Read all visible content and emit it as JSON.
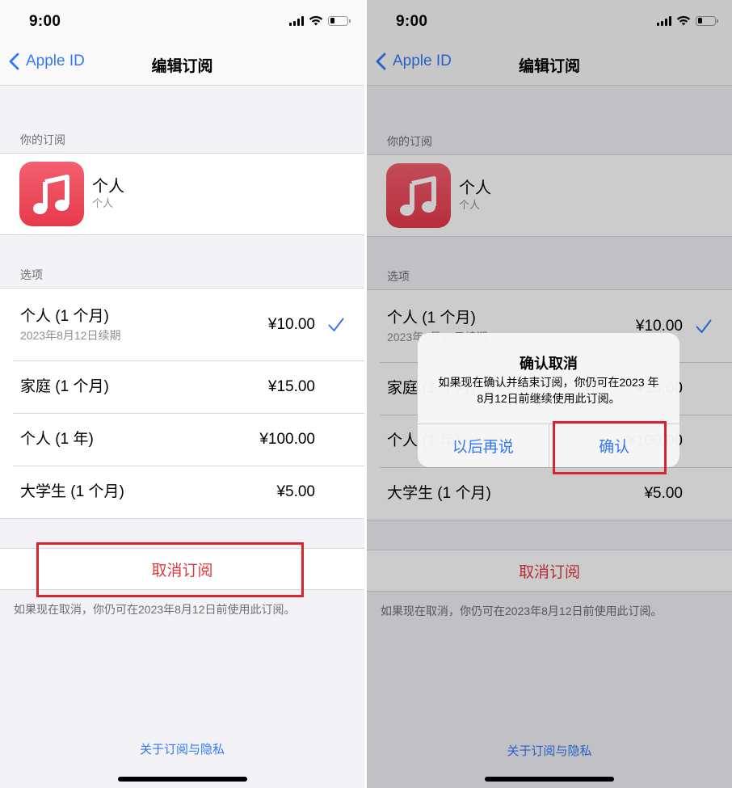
{
  "colors": {
    "accent": "#3478f6",
    "destructive": "#e0383e",
    "highlight_box": "#d9232d",
    "background": "#f2f2f7",
    "app_icon": "#ea4556"
  },
  "status_bar": {
    "time": "9:00",
    "icons": [
      "cellular-signal-icon",
      "wifi-icon",
      "battery-low-icon"
    ]
  },
  "nav": {
    "back_label": "Apple ID",
    "back_icon": "chevron-left-icon",
    "title": "编辑订阅"
  },
  "subscription_section": {
    "header": "你的订阅",
    "app_icon": "music-note-icon",
    "title": "个人",
    "subtitle": "个人"
  },
  "options_section": {
    "header": "选项",
    "options": [
      {
        "label": "个人 (1 个月)",
        "sublabel": "2023年8月12日续期",
        "price": "¥10.00",
        "selected": true
      },
      {
        "label": "家庭 (1 个月)",
        "price": "¥15.00",
        "selected": false
      },
      {
        "label": "个人 (1 年)",
        "price": "¥100.00",
        "selected": false
      },
      {
        "label": "大学生 (1 个月)",
        "price": "¥5.00",
        "selected": false
      }
    ]
  },
  "cancel": {
    "button_label": "取消订阅",
    "footnote": "如果现在取消，你仍可在2023年8月12日前使用此订阅。"
  },
  "privacy_link": "关于订阅与隐私",
  "alert": {
    "title": "确认取消",
    "message": "如果现在确认并结束订阅，你仍可在2023 年 8月12日前继续使用此订阅。",
    "secondary_label": "以后再说",
    "confirm_label": "确认"
  }
}
